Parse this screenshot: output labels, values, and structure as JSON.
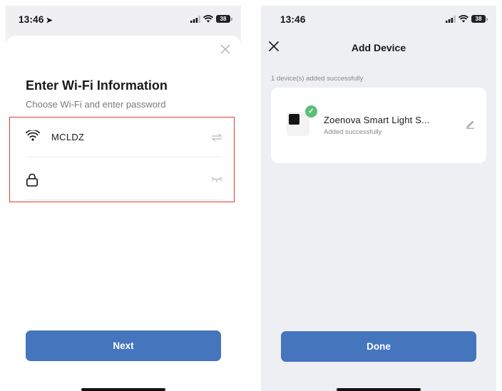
{
  "left_screen": {
    "status_bar": {
      "time": "13:46",
      "battery": "38"
    },
    "title": "Enter Wi-Fi Information",
    "subtitle": "Choose Wi-Fi and enter password",
    "wifi_field": {
      "value": "MCLDZ",
      "icon": "wifi-icon",
      "trailing_icon": "switch-arrows-icon"
    },
    "password_field": {
      "value": "",
      "icon": "lock-icon",
      "trailing_icon": "eye-closed-icon"
    },
    "next_button": "Next"
  },
  "right_screen": {
    "status_bar": {
      "time": "13:46",
      "battery": "38"
    },
    "nav_title": "Add Device",
    "added_count": "1 device(s) added successfully",
    "device": {
      "name": "Zoenova Smart Light S...",
      "status": "Added successfully"
    },
    "done_button": "Done"
  },
  "colors": {
    "primary": "#4575bc",
    "success": "#5bbf75",
    "highlight_border": "#e23a3a"
  }
}
